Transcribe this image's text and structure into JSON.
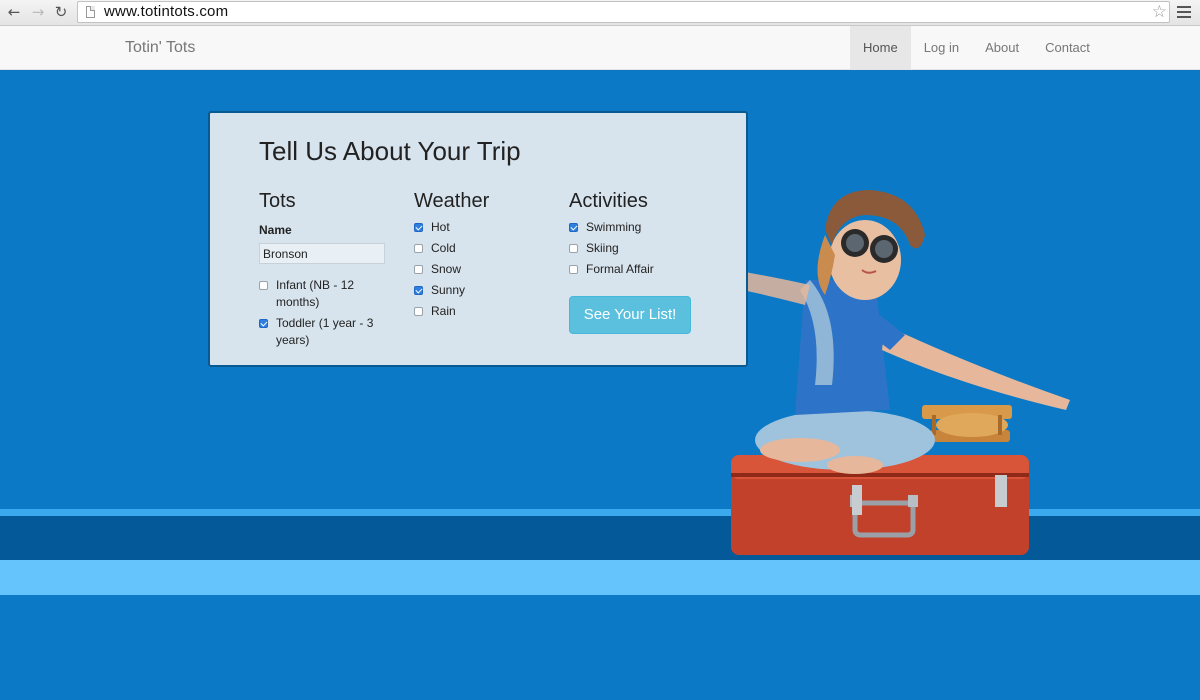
{
  "browser": {
    "url": "www.totintots.com"
  },
  "navbar": {
    "brand": "Totin' Tots",
    "links": [
      "Home",
      "Log in",
      "About",
      "Contact"
    ],
    "active": "Home"
  },
  "form": {
    "title": "Tell Us About Your Trip",
    "tots": {
      "heading": "Tots",
      "name_label": "Name",
      "name_value": "Bronson",
      "options": [
        {
          "label": "Infant (NB - 12 months)",
          "checked": false
        },
        {
          "label": "Toddler (1 year - 3 years)",
          "checked": true
        }
      ]
    },
    "weather": {
      "heading": "Weather",
      "options": [
        {
          "label": "Hot",
          "checked": true
        },
        {
          "label": "Cold",
          "checked": false
        },
        {
          "label": "Snow",
          "checked": false
        },
        {
          "label": "Sunny",
          "checked": true
        },
        {
          "label": "Rain",
          "checked": false
        }
      ]
    },
    "activities": {
      "heading": "Activities",
      "options": [
        {
          "label": "Swimming",
          "checked": true
        },
        {
          "label": "Skiing",
          "checked": false
        },
        {
          "label": "Formal Affair",
          "checked": false
        }
      ]
    },
    "submit_label": "See Your List!"
  },
  "colors": {
    "background": "#0b79c6",
    "panel": "#d8e4ed",
    "button": "#5bc0de",
    "checkbox_checked": "#2f7fe0"
  }
}
